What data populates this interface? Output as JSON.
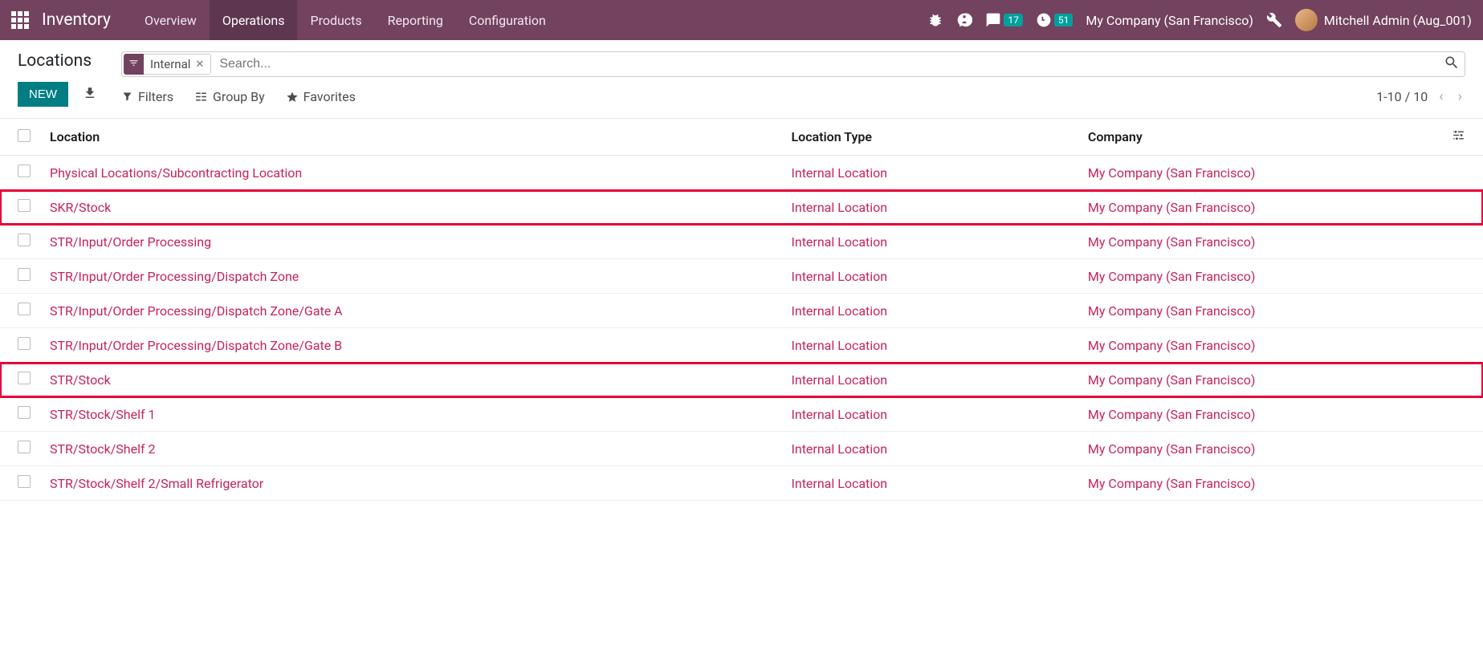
{
  "nav": {
    "brand": "Inventory",
    "items": [
      "Overview",
      "Operations",
      "Products",
      "Reporting",
      "Configuration"
    ],
    "active_index": 1,
    "messages_badge": "17",
    "activities_badge": "51",
    "company": "My Company (San Francisco)",
    "user": "Mitchell Admin (Aug_001)"
  },
  "page": {
    "title": "Locations",
    "new_label": "NEW"
  },
  "search": {
    "chip_label": "Internal",
    "placeholder": "Search..."
  },
  "toolbar": {
    "filters": "Filters",
    "group_by": "Group By",
    "favorites": "Favorites",
    "pager": "1-10 / 10"
  },
  "table": {
    "headers": {
      "location": "Location",
      "type": "Location Type",
      "company": "Company"
    },
    "rows": [
      {
        "location": "Physical Locations/Subcontracting Location",
        "type": "Internal Location",
        "company": "My Company (San Francisco)",
        "highlight": false
      },
      {
        "location": "SKR/Stock",
        "type": "Internal Location",
        "company": "My Company (San Francisco)",
        "highlight": true
      },
      {
        "location": "STR/Input/Order Processing",
        "type": "Internal Location",
        "company": "My Company (San Francisco)",
        "highlight": false
      },
      {
        "location": "STR/Input/Order Processing/Dispatch Zone",
        "type": "Internal Location",
        "company": "My Company (San Francisco)",
        "highlight": false
      },
      {
        "location": "STR/Input/Order Processing/Dispatch Zone/Gate A",
        "type": "Internal Location",
        "company": "My Company (San Francisco)",
        "highlight": false
      },
      {
        "location": "STR/Input/Order Processing/Dispatch Zone/Gate B",
        "type": "Internal Location",
        "company": "My Company (San Francisco)",
        "highlight": false
      },
      {
        "location": "STR/Stock",
        "type": "Internal Location",
        "company": "My Company (San Francisco)",
        "highlight": true
      },
      {
        "location": "STR/Stock/Shelf 1",
        "type": "Internal Location",
        "company": "My Company (San Francisco)",
        "highlight": false
      },
      {
        "location": "STR/Stock/Shelf 2",
        "type": "Internal Location",
        "company": "My Company (San Francisco)",
        "highlight": false
      },
      {
        "location": "STR/Stock/Shelf 2/Small Refrigerator",
        "type": "Internal Location",
        "company": "My Company (San Francisco)",
        "highlight": false
      }
    ]
  }
}
